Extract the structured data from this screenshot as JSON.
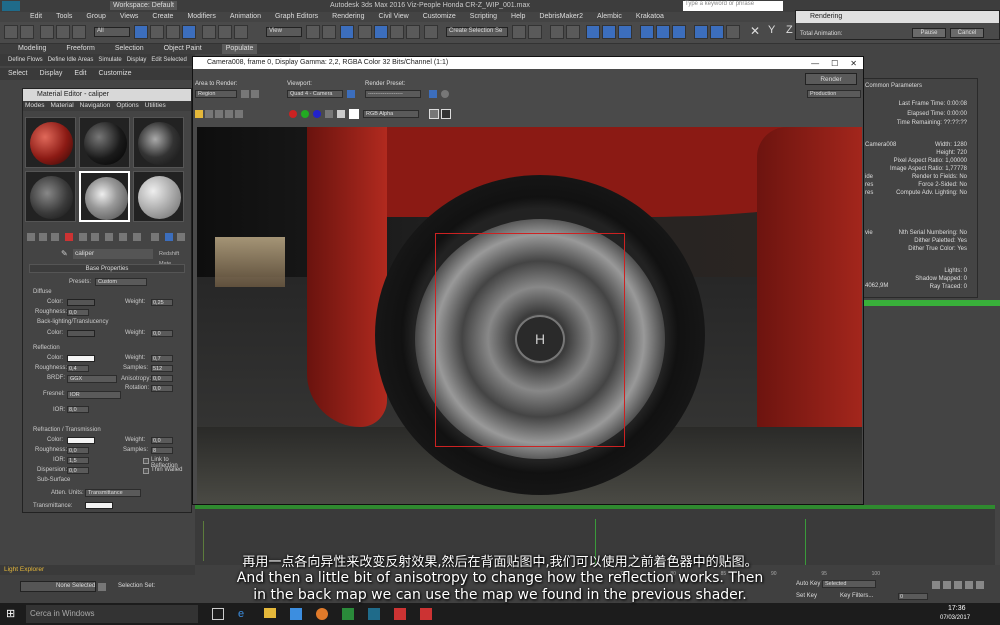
{
  "app": {
    "title": "Autodesk 3ds Max 2016    Viz-People Honda CR-Z_WIP_001.max",
    "workspace": "Workspace: Default",
    "search_placeholder": "Type a keyword or phrase"
  },
  "menubar": [
    "Edit",
    "Tools",
    "Group",
    "Views",
    "Create",
    "Modifiers",
    "Animation",
    "Graph Editors",
    "Rendering",
    "Civil View",
    "Customize",
    "Scripting",
    "Help",
    "DebrisMaker2",
    "Alembic",
    "Krakatoa"
  ],
  "toolbar": {
    "filter": "All",
    "view": "View",
    "selection_set": "Create Selection Se"
  },
  "ribbon_tabs": [
    "Modeling",
    "Freeform",
    "Selection",
    "Object Paint",
    "Populate"
  ],
  "ribbon_sub": [
    "Define Flows",
    "Define Idle Areas",
    "Simulate",
    "Display",
    "Edit Selected"
  ],
  "left_menu": [
    "Select",
    "Display",
    "Edit",
    "Customize"
  ],
  "material_editor": {
    "title": "Material Editor - caliper",
    "menu": [
      "Modes",
      "Material",
      "Navigation",
      "Options",
      "Utilities"
    ],
    "material_name": "caliper",
    "renderer_tag": "Redshift Mate",
    "rollout_title": "Base Properties",
    "presets_label": "Presets:",
    "presets_value": "Custom",
    "diffuse": {
      "section": "Diffuse",
      "color_label": "Color:",
      "weight_label": "Weight:",
      "weight_value": "0,25",
      "roughness_label": "Roughness:",
      "roughness_value": "0,0",
      "backlight": "Back-lighting/Translucency",
      "bl_color_label": "Color:",
      "bl_weight_label": "Weight:",
      "bl_weight_value": "0,0"
    },
    "reflection": {
      "section": "Reflection",
      "color_label": "Color:",
      "weight_label": "Weight:",
      "weight_value": "0,7",
      "roughness_label": "Roughness:",
      "roughness_value": "0,4",
      "samples_label": "Samples:",
      "samples_value": "512",
      "brdf_label": "BRDF:",
      "brdf_value": "GGX",
      "anisotropy_label": "Anisotropy:",
      "anisotropy_value": "0,0",
      "rotation_label": "Rotation:",
      "rotation_value": "0,0",
      "fresnel_label": "Fresnel:",
      "fresnel_value": "IOR",
      "ior_label": "IOR:",
      "ior_value": "8,0"
    },
    "refraction": {
      "section": "Refraction / Transmission",
      "color_label": "Color:",
      "weight_label": "Weight:",
      "weight_value": "0,0",
      "roughness_label": "Roughness:",
      "roughness_value": "0,0",
      "samples_label": "Samples:",
      "samples_value": "8",
      "ior_label": "IOR:",
      "ior_value": "1,5",
      "link_label": "Link to Reflection",
      "dispersion_label": "Dispersion:",
      "dispersion_value": "0,0",
      "thin_walled": "Thin Walled",
      "subsurface": "Sub-Surface",
      "atten_label": "Atten. Units:",
      "atten_value": "Transmittance",
      "transmittance_label": "Transmittance:"
    }
  },
  "frame_window": {
    "title": "Camera008, frame 0, Display Gamma: 2,2, RGBA Color 32 Bits/Channel (1:1)",
    "area_to_render_label": "Area to Render:",
    "area_to_render_value": "Region",
    "viewport_label": "Viewport:",
    "viewport_value": "Quad 4 - Camera",
    "render_preset_label": "Render Preset:",
    "render_preset_value": "-------------------",
    "render_button": "Render",
    "production_value": "Production",
    "channel_value": "RGB Alpha"
  },
  "rendering_dialog": {
    "title": "Rendering",
    "total_animation": "Total Animation:",
    "pause": "Pause",
    "cancel": "Cancel"
  },
  "common_params": {
    "header": "Common Parameters",
    "last_frame_time": "Last Frame Time:  0:00:08",
    "elapsed_time": "Elapsed Time:  0:00:00",
    "time_remaining": "Time Remaining: ??:??:??",
    "camera": "Camera008",
    "width": "Width:  1280",
    "height": "Height:  720",
    "pixel_aspect": "Pixel Aspect Ratio: 1,00000",
    "image_aspect": "Image Aspect Ratio: 1,77778",
    "render_to_fields": "Render to Fields: No",
    "force_2sided": "Force 2-Sided: No",
    "compute_adv": "Compute Adv. Lighting: No",
    "nth_serial": "Nth Serial Numbering: No",
    "dither_paletted": "Dither Paletted: Yes",
    "dither_true": "Dither True Color: Yes",
    "lights": "Lights: 0",
    "shadow_mapped": "Shadow Mapped: 0",
    "ray_traced": "Ray Traced: 0",
    "side_labels": [
      "ide",
      "res",
      "res",
      "vie"
    ],
    "mem": "4062,9M"
  },
  "status": {
    "light_explorer": "Light Explorer",
    "none_selected": "None Selected",
    "selection_set": "Selection Set:",
    "auto_key": "Auto Key",
    "selected": "Selected",
    "set_key": "Set Key",
    "key_filters": "Key Filters...",
    "frame": "0",
    "timeline_end": "100",
    "timeline_ticks": [
      "75",
      "80",
      "85",
      "90",
      "95",
      "100"
    ]
  },
  "taskbar": {
    "search": "Cerca in Windows",
    "time": "17:36",
    "date": "07/03/2017"
  },
  "subtitles": {
    "zh": "再用一点各向异性来改变反射效果,然后在背面贴图中,我们可以使用之前着色器中的贴图。",
    "en_line1": "And then a little bit of anisotropy to change how the reflection works. Then",
    "en_line2": "in the back map we can use the map we found in the previous shader."
  },
  "colors": {
    "accent_blue": "#3c6ebd",
    "region_red": "#cc2222",
    "green_grid": "#39b03a",
    "car_red": "#8b1a14"
  }
}
